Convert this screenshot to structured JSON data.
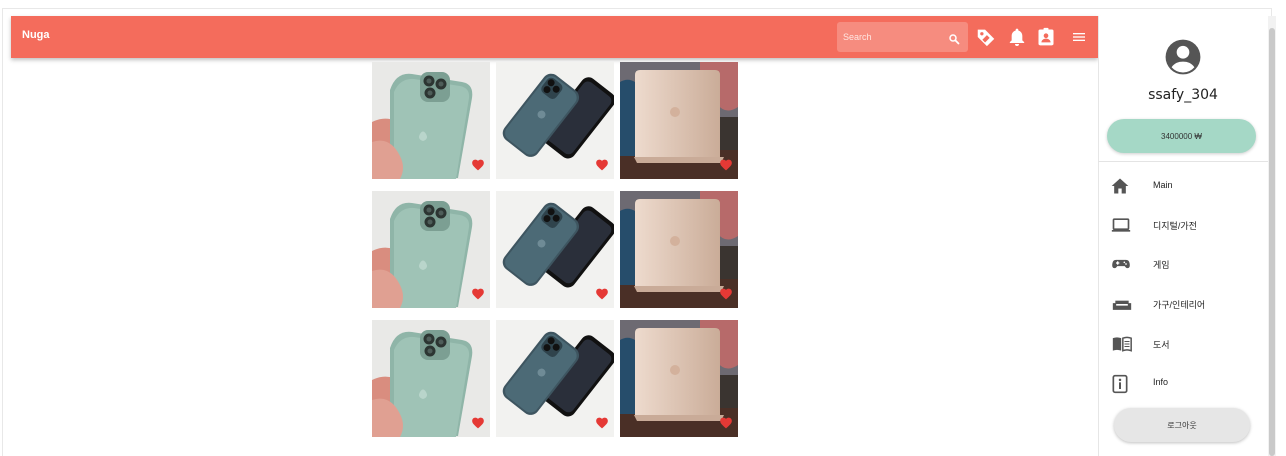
{
  "appbar": {
    "brand": "Nuga",
    "search_placeholder": "Search",
    "icons": [
      "search-icon",
      "tag-icon",
      "bell-icon",
      "contact-card-icon",
      "menu-icon"
    ],
    "color": "#f46c5c"
  },
  "products": [
    {
      "image": "phone-green"
    },
    {
      "image": "phone-blue"
    },
    {
      "image": "laptop-gold"
    },
    {
      "image": "phone-green"
    },
    {
      "image": "phone-blue"
    },
    {
      "image": "laptop-gold"
    },
    {
      "image": "phone-green"
    },
    {
      "image": "phone-blue"
    },
    {
      "image": "laptop-gold"
    }
  ],
  "drawer": {
    "username": "ssafy_304",
    "balance": "3400000 ₩",
    "menu": [
      {
        "label": "Main",
        "icon": "home-icon"
      },
      {
        "label": "디지털/가전",
        "icon": "laptop-icon"
      },
      {
        "label": "게임",
        "icon": "gamepad-icon"
      },
      {
        "label": "가구/인테리어",
        "icon": "sofa-icon"
      },
      {
        "label": "도서",
        "icon": "book-icon"
      },
      {
        "label": "Info",
        "icon": "info-icon"
      }
    ],
    "logout_label": "로그아웃"
  }
}
